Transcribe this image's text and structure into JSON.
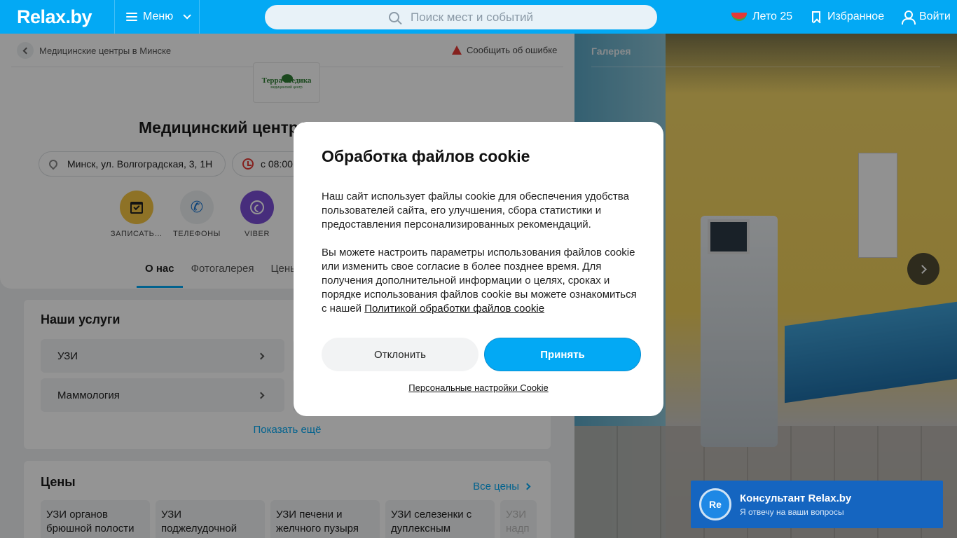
{
  "header": {
    "logo": "Relax.by",
    "menu_label": "Меню",
    "search_placeholder": "Поиск мест и событий",
    "summer_label": "Лето 25",
    "favorites_label": "Избранное",
    "login_label": "Войти",
    "brand_color": "#03a9f4"
  },
  "breadcrumb": {
    "label": "Медицинские центры в Минске"
  },
  "report_label": "Сообщить об ошибке",
  "place": {
    "logo_name": "Терра Медика",
    "logo_sub": "медицинский центр",
    "title": "Медицинский центр Терра Медика",
    "address": "Минск, ул. Волгоградская, 3, 1Н",
    "hours": "с 08:00"
  },
  "actions": [
    {
      "label": "ЗАПИСАТЬ…",
      "icon": "calendar-check-icon",
      "color": "#f5c542"
    },
    {
      "label": "ТЕЛЕФОНЫ",
      "icon": "phone-icon",
      "color": "#eceff1"
    },
    {
      "label": "VIBER",
      "icon": "viber-icon",
      "color": "#7b4fd6"
    }
  ],
  "tabs": [
    "О нас",
    "Фотогалерея",
    "Цены"
  ],
  "services": {
    "title": "Наши услуги",
    "items": [
      "УЗИ",
      "Маммология"
    ],
    "show_more": "Показать ещё"
  },
  "prices": {
    "title": "Цены",
    "all_label": "Все цены",
    "tiles": [
      "УЗИ органов брюшной полости",
      "УЗИ поджелудочной",
      "УЗИ печени и желчного пузыря",
      "УЗИ селезенки с дуплексным",
      "УЗИ надп"
    ]
  },
  "gallery": {
    "title": "Галерея"
  },
  "consultant": {
    "avatar": "Re",
    "title": "Консультант Relax.by",
    "subtitle": "Я отвечу на ваши вопросы"
  },
  "cookie": {
    "title": "Обработка файлов cookie",
    "text1": "Наш сайт использует файлы cookie для обеспечения удобства пользователей сайта, его улучшения, сбора статистики и предоставления персонализированных рекомендаций.",
    "text2": "Вы можете настроить параметры использования файлов cookie или изменить свое согласие в более позднее время. Для получения дополнительной информации о целях, сроках и порядке использования файлов cookie вы можете ознакомиться с нашей ",
    "policy_link": "Политикой обработки файлов cookie",
    "decline": "Отклонить",
    "accept": "Принять",
    "personal": "Персональные настройки Cookie"
  }
}
